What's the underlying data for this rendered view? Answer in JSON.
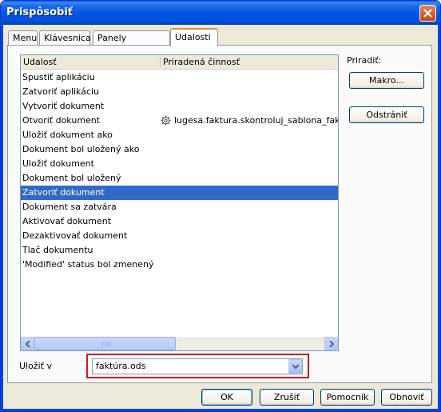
{
  "window": {
    "title": "Prispôsobiť"
  },
  "tabs": [
    {
      "label": "Menu"
    },
    {
      "label": "Klávesnica"
    },
    {
      "label": "Panely nástrojov"
    },
    {
      "label": "Udalosti"
    }
  ],
  "events_list": {
    "columns": [
      "Udalosť",
      "Priradená činnosť"
    ],
    "rows": [
      {
        "event": "Spustiť aplikáciu",
        "action": ""
      },
      {
        "event": "Zatvoriť aplikáciu",
        "action": ""
      },
      {
        "event": "Vytvoriť dokument",
        "action": ""
      },
      {
        "event": "Otvoriť dokument",
        "action": "lugesa.faktura.skontroluj_sablona_faktura"
      },
      {
        "event": "Uložiť dokument ako",
        "action": ""
      },
      {
        "event": "Dokument bol uložený ako",
        "action": ""
      },
      {
        "event": "Uložiť dokument",
        "action": ""
      },
      {
        "event": "Dokument bol uložený",
        "action": ""
      },
      {
        "event": "Zatvoriť dokument",
        "action": ""
      },
      {
        "event": "Dokument sa zatvára",
        "action": ""
      },
      {
        "event": "Aktivovať dokument",
        "action": ""
      },
      {
        "event": "Dezaktivovať dokument",
        "action": ""
      },
      {
        "event": "Tlač dokumentu",
        "action": ""
      },
      {
        "event": "'Modified' status bol zmenený",
        "action": ""
      }
    ],
    "selected_index": 8
  },
  "assign": {
    "label": "Priradiť:",
    "macro_button": "Makro...",
    "remove_button": "Odstrániť"
  },
  "save_in": {
    "label": "Uložiť v",
    "value": "faktúra.ods"
  },
  "buttons": {
    "ok": "OK",
    "cancel": "Zrušiť",
    "help": "Pomocník",
    "reset": "Obnoviť"
  },
  "colors": {
    "selection": "#316ac5",
    "highlight_border": "#d11a1a",
    "active_tab_accent": "#e68b2c"
  }
}
